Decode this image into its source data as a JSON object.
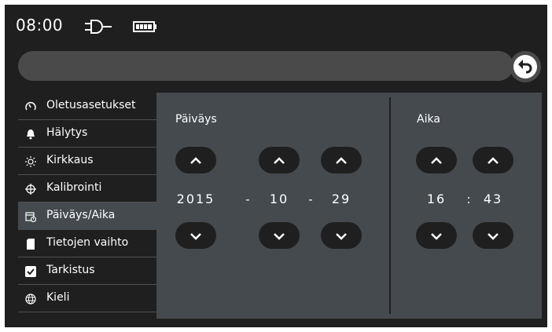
{
  "status": {
    "time": "08:00",
    "power_icon": "plug-icon",
    "battery_icon": "battery-icon"
  },
  "pathbar": {
    "back_icon": "back-arrow-icon"
  },
  "sidebar": {
    "items": [
      {
        "label": "Oletusasetukset",
        "icon": "gauge-icon"
      },
      {
        "label": "Hälytys",
        "icon": "bell-icon"
      },
      {
        "label": "Kirkkaus",
        "icon": "brightness-icon"
      },
      {
        "label": "Kalibrointi",
        "icon": "crosshair-icon"
      },
      {
        "label": "Päiväys/Aika",
        "icon": "calendar-clock-icon",
        "active": true
      },
      {
        "label": "Tietojen vaihto",
        "icon": "sd-card-icon"
      },
      {
        "label": "Tarkistus",
        "icon": "checkbox-icon"
      },
      {
        "label": "Kieli",
        "icon": "globe-icon"
      }
    ]
  },
  "date": {
    "label": "Päiväys",
    "year": "2015",
    "month": "10",
    "day": "29",
    "separator": "-"
  },
  "time": {
    "label": "Aika",
    "hour": "16",
    "minute": "43",
    "separator": ":"
  },
  "colors": {
    "background": "#1f1f1f",
    "panel": "#454a4f",
    "bar": "#4a4a4a",
    "text": "#ffffff"
  }
}
